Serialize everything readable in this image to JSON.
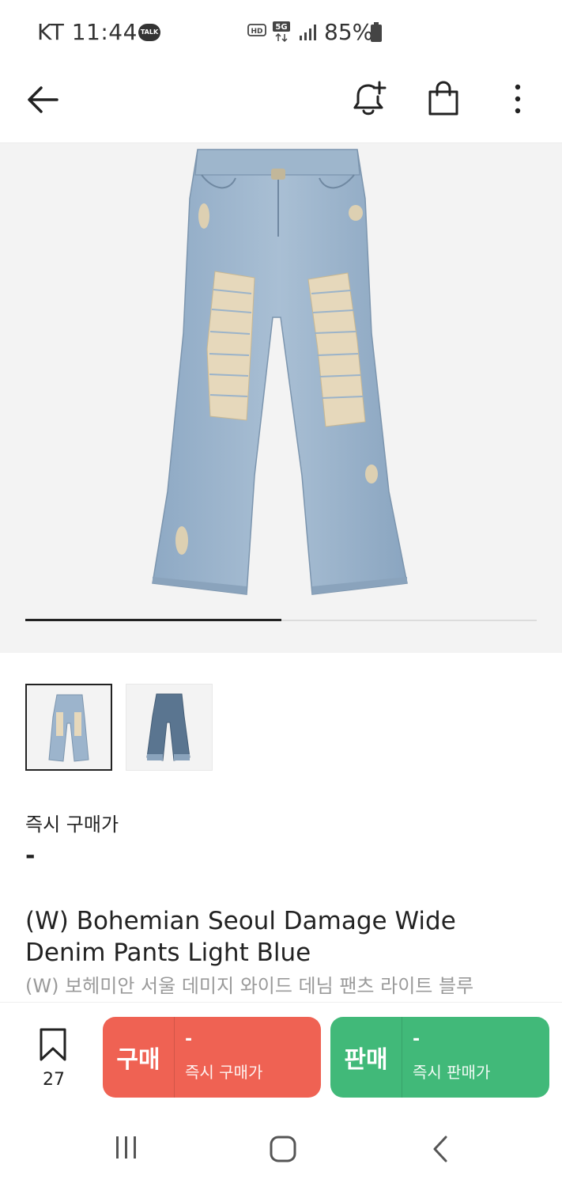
{
  "status_bar": {
    "carrier_time": "KT 11:44",
    "talk_badge": "TALK",
    "hd": "HD",
    "network": "5G",
    "battery": "85%"
  },
  "header": {
    "back_icon": "arrow-left-icon",
    "alert_icon": "bell-plus-icon",
    "bag_icon": "shopping-bag-icon",
    "more_icon": "more-vertical-icon"
  },
  "gallery": {
    "image_count": 2,
    "current_image": 1,
    "colors": {
      "denim_light": "#9cb4cc",
      "denim_dark": "#5a7590",
      "damage": "#e8dcc0"
    }
  },
  "price": {
    "label": "즉시 구매가",
    "value": "-"
  },
  "product": {
    "title_en": "(W) Bohemian Seoul Damage Wide Denim Pants Light Blue",
    "title_ko": "(W) 보헤미안 서울 데미지 와이드 데님 팬츠 라이트 블루"
  },
  "bottom_bar": {
    "wish_count": "27",
    "buy": {
      "label": "구매",
      "price": "-",
      "sub": "즉시 구매가",
      "color": "#ef6253"
    },
    "sell": {
      "label": "판매",
      "price": "-",
      "sub": "즉시 판매가",
      "color": "#41b979"
    }
  }
}
